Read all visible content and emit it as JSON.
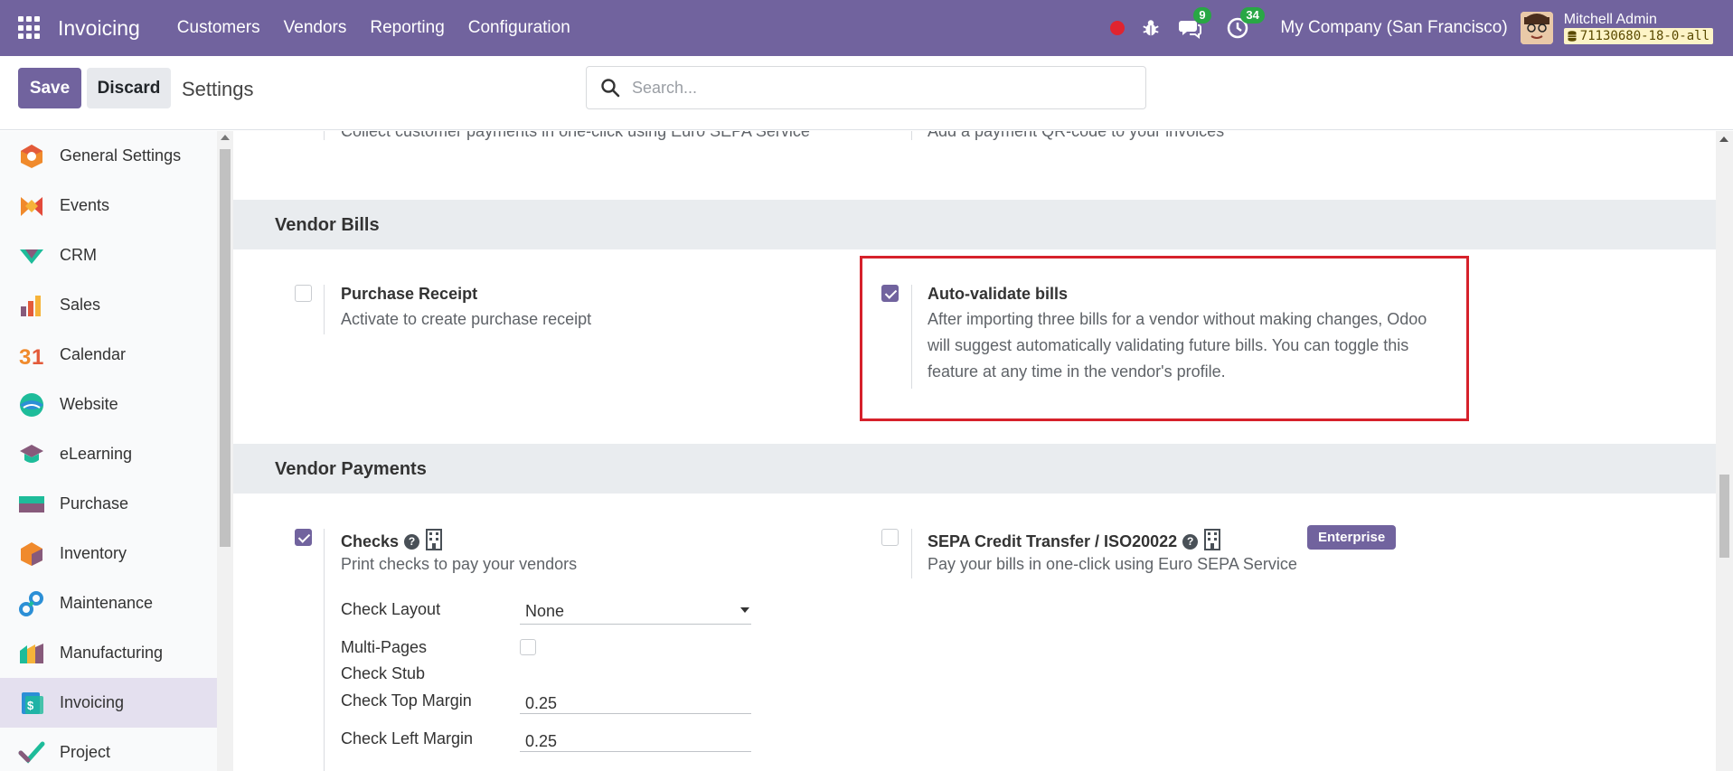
{
  "navbar": {
    "app_name": "Invoicing",
    "menu": [
      "Customers",
      "Vendors",
      "Reporting",
      "Configuration"
    ],
    "messages_count": "9",
    "activities_count": "34",
    "company": "My Company (San Francisco)",
    "user_name": "Mitchell Admin",
    "database": "71130680-18-0-all",
    "icons": [
      "apps-grid-icon",
      "record-icon",
      "bug-icon",
      "chat-icon",
      "clock-icon",
      "database-icon"
    ]
  },
  "control_panel": {
    "save_label": "Save",
    "discard_label": "Discard",
    "title": "Settings",
    "search_placeholder": "Search..."
  },
  "sidebar": {
    "items": [
      {
        "label": "General Settings",
        "icon": "general-settings-icon"
      },
      {
        "label": "Events",
        "icon": "events-icon"
      },
      {
        "label": "CRM",
        "icon": "crm-icon"
      },
      {
        "label": "Sales",
        "icon": "sales-icon"
      },
      {
        "label": "Calendar",
        "icon": "calendar-icon"
      },
      {
        "label": "Website",
        "icon": "website-icon"
      },
      {
        "label": "eLearning",
        "icon": "elearning-icon"
      },
      {
        "label": "Purchase",
        "icon": "purchase-icon"
      },
      {
        "label": "Inventory",
        "icon": "inventory-icon"
      },
      {
        "label": "Maintenance",
        "icon": "maintenance-icon"
      },
      {
        "label": "Manufacturing",
        "icon": "manufacturing-icon"
      },
      {
        "label": "Invoicing",
        "icon": "invoicing-icon",
        "active": true
      },
      {
        "label": "Project",
        "icon": "project-icon"
      }
    ]
  },
  "top_partial": {
    "left_desc": "Collect customer payments in one-click using Euro SEPA Service",
    "right_desc": "Add a payment QR-code to your invoices"
  },
  "vendor_bills": {
    "header": "Vendor Bills",
    "purchase_receipt": {
      "title": "Purchase Receipt",
      "desc": "Activate to create purchase receipt",
      "checked": false
    },
    "auto_validate": {
      "title": "Auto-validate bills",
      "desc": "After importing three bills for a vendor without making changes, Odoo will suggest automatically validating future bills. You can toggle this feature at any time in the vendor's profile.",
      "checked": true
    }
  },
  "vendor_payments": {
    "header": "Vendor Payments",
    "checks": {
      "title": "Checks",
      "desc": "Print checks to pay your vendors",
      "checked": true,
      "check_layout_label": "Check Layout",
      "check_layout_value": "None",
      "multi_pages_label": "Multi-Pages",
      "check_stub_label": "Check Stub",
      "top_margin_label": "Check Top Margin",
      "top_margin_value": "0.25",
      "left_margin_label": "Check Left Margin",
      "left_margin_value": "0.25"
    },
    "sepa": {
      "title": "SEPA Credit Transfer / ISO20022",
      "desc": "Pay your bills in one-click using Euro SEPA Service",
      "badge": "Enterprise",
      "checked": false
    }
  },
  "colors": {
    "accent": "#71639e",
    "highlight": "#d6212b",
    "badge_green": "#29a745"
  }
}
